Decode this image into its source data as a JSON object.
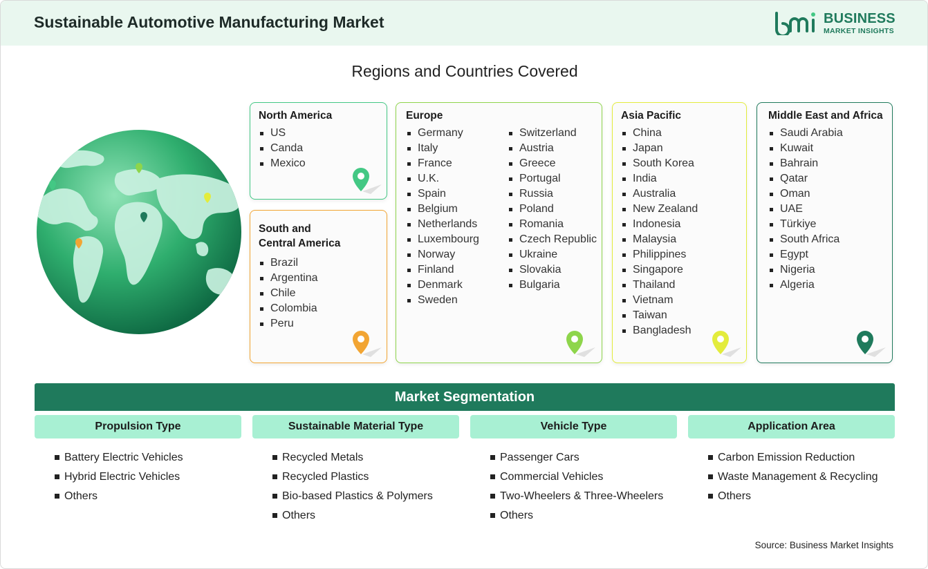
{
  "header": {
    "title": "Sustainable Automotive Manufacturing Market"
  },
  "logo": {
    "mark": "bmi",
    "line1": "BUSINESS",
    "line2": "MARKET INSIGHTS"
  },
  "regions": {
    "title": "Regions and Countries Covered",
    "north_america": {
      "name": "North America",
      "items": [
        "US",
        "Canda",
        "Mexico"
      ]
    },
    "south_america": {
      "name_line1": "South and",
      "name_line2": "Central America",
      "items": [
        "Brazil",
        "Argentina",
        "Chile",
        "Colombia",
        "Peru"
      ]
    },
    "europe": {
      "name": "Europe",
      "col1": [
        "Germany",
        "Italy",
        "France",
        "U.K.",
        "Spain",
        "Belgium",
        "Netherlands",
        "Luxembourg",
        "Norway",
        "Finland",
        "Denmark",
        "Sweden"
      ],
      "col2": [
        "Switzerland",
        "Austria",
        "Greece",
        "Portugal",
        "Russia",
        "Poland",
        "Romania",
        "Czech Republic",
        "Ukraine",
        "Slovakia",
        "Bulgaria"
      ]
    },
    "asia_pacific": {
      "name": "Asia Pacific",
      "items": [
        "China",
        "Japan",
        "South Korea",
        "India",
        "Australia",
        "New Zealand",
        "Indonesia",
        "Malaysia",
        "Philippines",
        "Singapore",
        "Thailand",
        "Vietnam",
        "Taiwan",
        "Bangladesh"
      ]
    },
    "mea": {
      "name": "Middle East and Africa",
      "items": [
        "Saudi Arabia",
        "Kuwait",
        "Bahrain",
        "Qatar",
        "Oman",
        "UAE",
        "Türkiye",
        "South Africa",
        "Egypt",
        "Nigeria",
        "Algeria"
      ]
    }
  },
  "colors": {
    "north_america": "#43c884",
    "south_america": "#f2a533",
    "europe": "#8ed54b",
    "asia_pacific": "#e3ec3c",
    "mea": "#1f7a5c",
    "brand": "#1f7a5c",
    "segment_head": "#a8f0d3"
  },
  "icons": {
    "region_marker": "map-pin-icon",
    "globe": "globe-icon"
  },
  "segmentation": {
    "title": "Market Segmentation",
    "groups": [
      {
        "title": "Propulsion Type",
        "items": [
          "Battery Electric Vehicles",
          "Hybrid Electric Vehicles",
          "Others"
        ]
      },
      {
        "title": "Sustainable Material Type",
        "items": [
          "Recycled Metals",
          "Recycled Plastics",
          "Bio-based Plastics & Polymers",
          "Others"
        ]
      },
      {
        "title": "Vehicle Type",
        "items": [
          "Passenger Cars",
          "Commercial Vehicles",
          "Two-Wheelers & Three-Wheelers",
          "Others"
        ]
      },
      {
        "title": "Application Area",
        "items": [
          "Carbon Emission Reduction",
          "Waste Management & Recycling",
          "Others"
        ]
      }
    ]
  },
  "footer": {
    "source": "Source: Business Market Insights"
  }
}
